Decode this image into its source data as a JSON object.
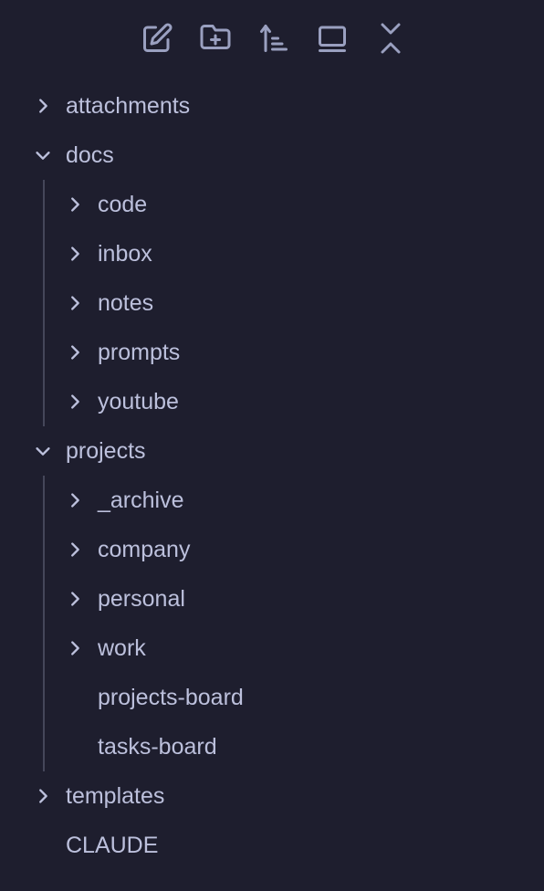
{
  "toolbar": {
    "buttons": [
      {
        "name": "new-note",
        "icon": "pencil-square-icon"
      },
      {
        "name": "new-folder",
        "icon": "folder-plus-icon"
      },
      {
        "name": "sort",
        "icon": "sort-icon"
      },
      {
        "name": "auto-reveal",
        "icon": "panel-icon"
      },
      {
        "name": "collapse-all",
        "icon": "collapse-all-icon"
      }
    ]
  },
  "tree": {
    "attachments": "attachments",
    "docs": "docs",
    "docs_children": [
      "code",
      "inbox",
      "notes",
      "prompts",
      "youtube"
    ],
    "projects": "projects",
    "projects_folders": [
      "_archive",
      "company",
      "personal",
      "work"
    ],
    "projects_files": [
      "projects-board",
      "tasks-board"
    ],
    "templates": "templates",
    "claude": "CLAUDE"
  },
  "colors": {
    "background": "#1e1e2e",
    "text": "#bcc0dc",
    "icon": "#9aa0c0",
    "guide": "#45475a"
  }
}
